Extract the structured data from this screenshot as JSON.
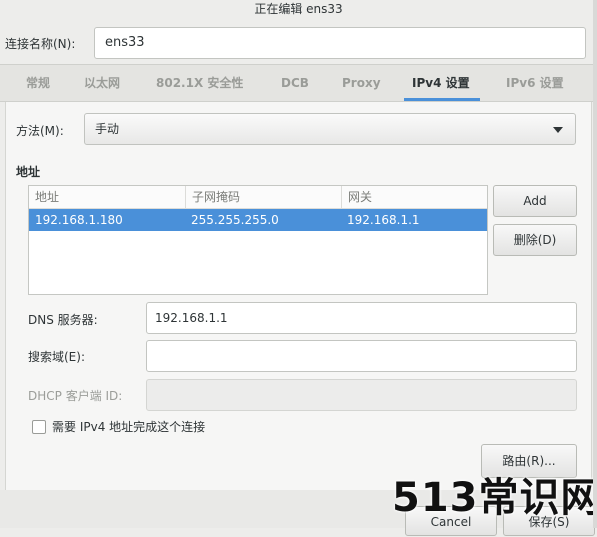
{
  "window": {
    "title": "正在编辑 ens33"
  },
  "connection": {
    "label": "连接名称(N):",
    "value": "ens33"
  },
  "tabs": [
    {
      "label": "常规",
      "active": false
    },
    {
      "label": "以太网",
      "active": false
    },
    {
      "label": "802.1X 安全性",
      "active": false
    },
    {
      "label": "DCB",
      "active": false
    },
    {
      "label": "Proxy",
      "active": false
    },
    {
      "label": "IPv4 设置",
      "active": true
    },
    {
      "label": "IPv6 设置",
      "active": false
    }
  ],
  "ipv4": {
    "method_label": "方法(M):",
    "method_value": "手动",
    "address_section": "地址",
    "table": {
      "headers": [
        "地址",
        "子网掩码",
        "网关"
      ],
      "rows": [
        [
          "192.168.1.180",
          "255.255.255.0",
          "192.168.1.1"
        ]
      ]
    },
    "add_label": "Add",
    "delete_label": "删除(D)",
    "dns_label": "DNS 服务器:",
    "dns_value": "192.168.1.1",
    "search_label": "搜索域(E):",
    "search_value": "",
    "dhcp_label": "DHCP 客户端 ID:",
    "dhcp_value": "",
    "require_label": "需要 IPv4 地址完成这个连接",
    "require_checked": false,
    "routes_label": "路由(R)..."
  },
  "footer": {
    "cancel_label": "Cancel",
    "save_label": "保存(S)"
  },
  "watermark": "513常识网",
  "colors": {
    "accent": "#4a90d9",
    "background": "#ededeb"
  }
}
